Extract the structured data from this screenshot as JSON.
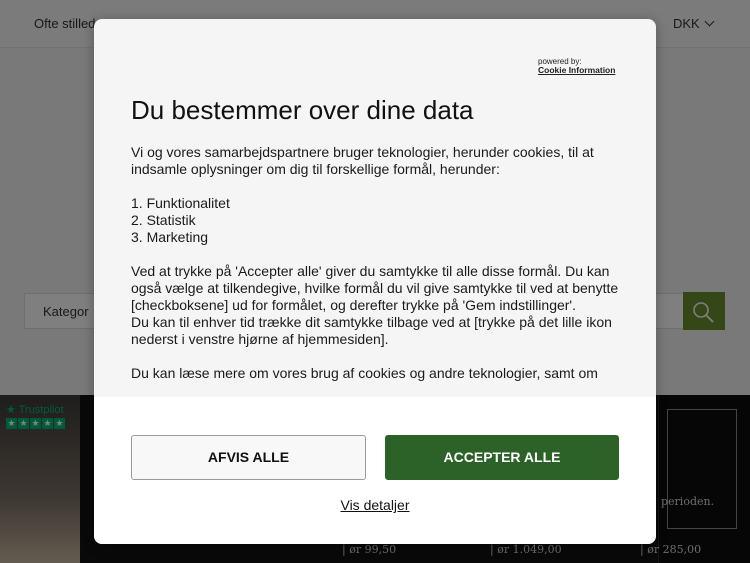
{
  "page": {
    "topbar": {
      "faq_label": "Ofte stilled",
      "currency_label": "DKK"
    },
    "search": {
      "category_label": "Kategor"
    },
    "banner": {
      "trustpilot": {
        "name": "Trustpilot",
        "stars": 5
      },
      "right_text": "perioden.",
      "prices": [
        "| ør 99,50",
        "| ør 1.049,00",
        "| ør 285,00"
      ]
    }
  },
  "consent": {
    "powered_by": "powered by:",
    "provider": "Cookie Information",
    "title": "Du bestemmer over dine data",
    "intro": "Vi og vores samarbejdspartnere bruger teknologier, herunder cookies, til at indsamle oplysninger om dig til forskellige formål, herunder:",
    "purposes": [
      "1. Funktionalitet",
      "2. Statistik",
      "3. Marketing"
    ],
    "paragraph_consent": "Ved at trykke på 'Accepter alle' giver du samtykke til alle disse formål. Du kan også vælge at tilkendegive, hvilke formål du vil give samtykke til ved at benytte [checkboksene] ud for formålet, og derefter trykke på 'Gem indstillinger'.",
    "paragraph_withdraw": "Du kan til enhver tid trække dit samtykke tilbage ved at [trykke på det lille ikon nederst i venstre hjørne af hjemmesiden].",
    "paragraph_more": "Du kan læse mere om vores brug af cookies og andre teknologier, samt om",
    "reject_label": "AFVIS ALLE",
    "accept_label": "ACCEPTER ALLE",
    "details_label": "Vis detaljer"
  },
  "colors": {
    "accept": "#2c6227",
    "search_button": "#6c8f2f",
    "trustpilot": "#00b67a"
  }
}
